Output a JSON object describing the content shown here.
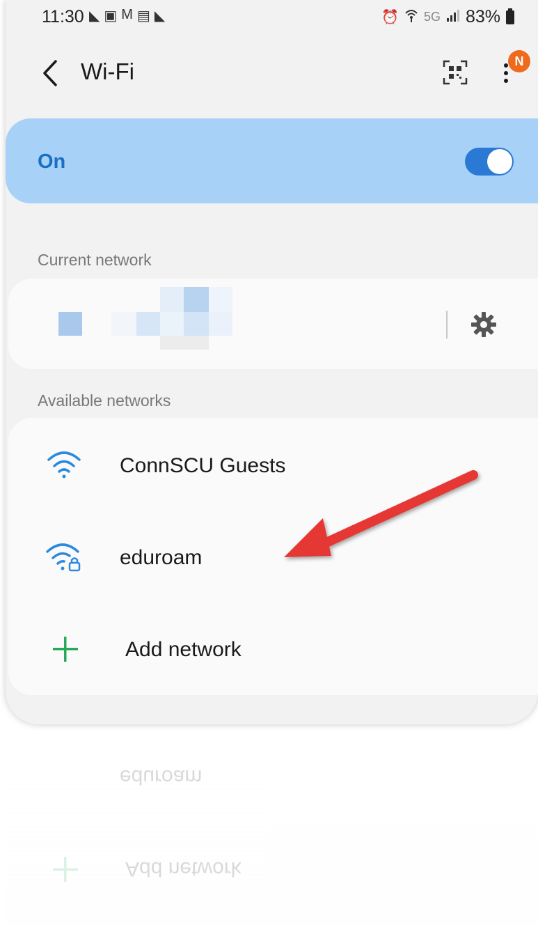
{
  "status_bar": {
    "time": "11:30",
    "network_type": "5G",
    "battery": "83%"
  },
  "header": {
    "back_icon": "chevron-left-icon",
    "title": "Wi-Fi",
    "qr_icon": "qr-code-scanner-icon",
    "more_icon": "more-vertical-icon",
    "notification_badge": "N"
  },
  "wifi_toggle": {
    "label": "On",
    "state": "on",
    "accent_color": "#2a7ad5",
    "background_color": "#a8d1f7"
  },
  "current_network": {
    "section_label": "Current network",
    "settings_icon": "gear-icon"
  },
  "available_networks": {
    "section_label": "Available networks",
    "items": [
      {
        "name": "ConnSCU Guests",
        "icon": "wifi-icon",
        "secured": false
      },
      {
        "name": "eduroam",
        "icon": "wifi-lock-icon",
        "secured": true
      }
    ],
    "add_network": {
      "label": "Add network",
      "icon": "plus-icon",
      "color": "#2aa85a"
    }
  },
  "annotation": {
    "arrow_color": "#e53935"
  }
}
